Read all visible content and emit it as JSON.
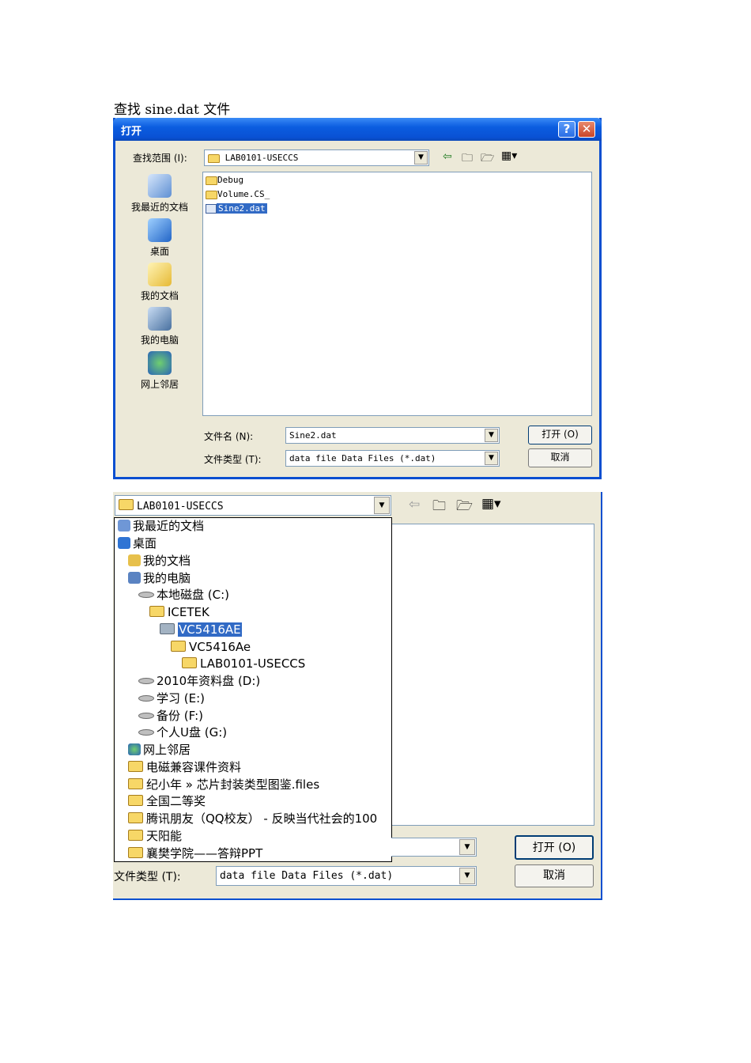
{
  "caption": "查找 sine.dat 文件",
  "dialog1": {
    "title": "打开",
    "help_glyph": "?",
    "close_glyph": "✕",
    "look_in_label": "查找范围 (I):",
    "look_in_value": "LAB0101-USECCS",
    "places": [
      "我最近的文档",
      "桌面",
      "我的文档",
      "我的电脑",
      "网上邻居"
    ],
    "files": [
      "Debug",
      "Volume.CS_",
      "Sine2.dat"
    ],
    "filename_label": "文件名 (N):",
    "filename_value": "Sine2.dat",
    "filetype_label": "文件类型 (T):",
    "filetype_value": "data file Data Files (*.dat)",
    "open_button": "打开 (O)",
    "cancel_button": "取消"
  },
  "dialog2": {
    "look_in_value": "LAB0101-USECCS",
    "dropdown_items": [
      "我最近的文档",
      "桌面",
      "我的文档",
      "我的电脑",
      "本地磁盘  (C:)",
      "ICETEK",
      "VC5416AE",
      "VC5416Ae",
      "LAB0101-USECCS",
      "2010年资料盘  (D:)",
      "学习  (E:)",
      "备份  (F:)",
      "个人U盘  (G:)",
      "网上邻居",
      "电磁兼容课件资料",
      "纪小年 » 芯片封装类型图鉴.files",
      "全国二等奖",
      "腾讯朋友（QQ校友） - 反映当代社会的100",
      "天阳能",
      "襄樊学院——答辩PPT"
    ],
    "filetype_label": "文件类型 (T):",
    "filetype_value": "data file Data Files (*.dat)",
    "open_button": "打开 (O)",
    "cancel_button": "取消"
  }
}
